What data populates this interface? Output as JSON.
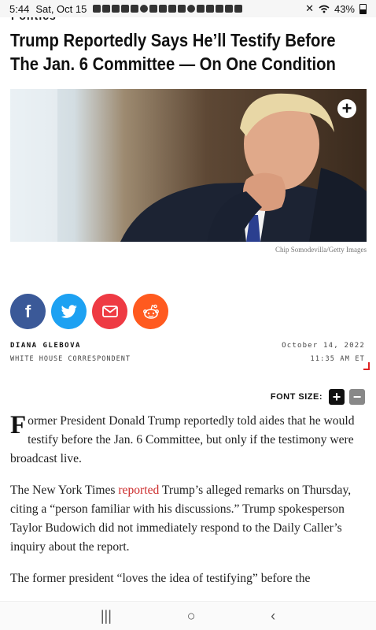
{
  "status_bar": {
    "time": "5:44",
    "date": "Sat, Oct 15",
    "battery": "43%"
  },
  "article": {
    "category": "Politics",
    "headline": "Trump Reportedly Says He’ll Testify Before The Jan. 6 Committee — On One Condition",
    "image_credit": "Chip Somodevilla/Getty Images",
    "author": "DIANA GLEBOVA",
    "author_role": "WHITE HOUSE CORRESPONDENT",
    "date": "October 14, 2022",
    "time": "11:35 AM ET",
    "font_size_label": "FONT SIZE:",
    "font_increase": "+",
    "font_decrease": "−",
    "p1_dropcap": "F",
    "p1_text": "ormer President Donald Trump reportedly told aides that he would testify before the Jan. 6 Committee, but only if the testimony were broadcast live.",
    "p2_before": "The New York Times ",
    "p2_link": "reported",
    "p2_after": " Trump’s alleged remarks on Thursday, citing a “person familiar with his discussions.” Trump spokesperson Taylor Budowich did not immediately respond to the Daily Caller’s inquiry about the report.",
    "p3_text": "The former president “loves the idea of testifying” before the"
  },
  "share": {
    "facebook": "f",
    "icons": [
      "facebook-icon",
      "twitter-icon",
      "email-icon",
      "reddit-icon"
    ]
  },
  "nav": {
    "recent": "|||",
    "home": "○",
    "back": "‹"
  },
  "colors": {
    "facebook": "#3b5998",
    "twitter": "#1da1f2",
    "email": "#ee3a43",
    "reddit": "#ff5a1f",
    "link": "#cc2a2a"
  }
}
